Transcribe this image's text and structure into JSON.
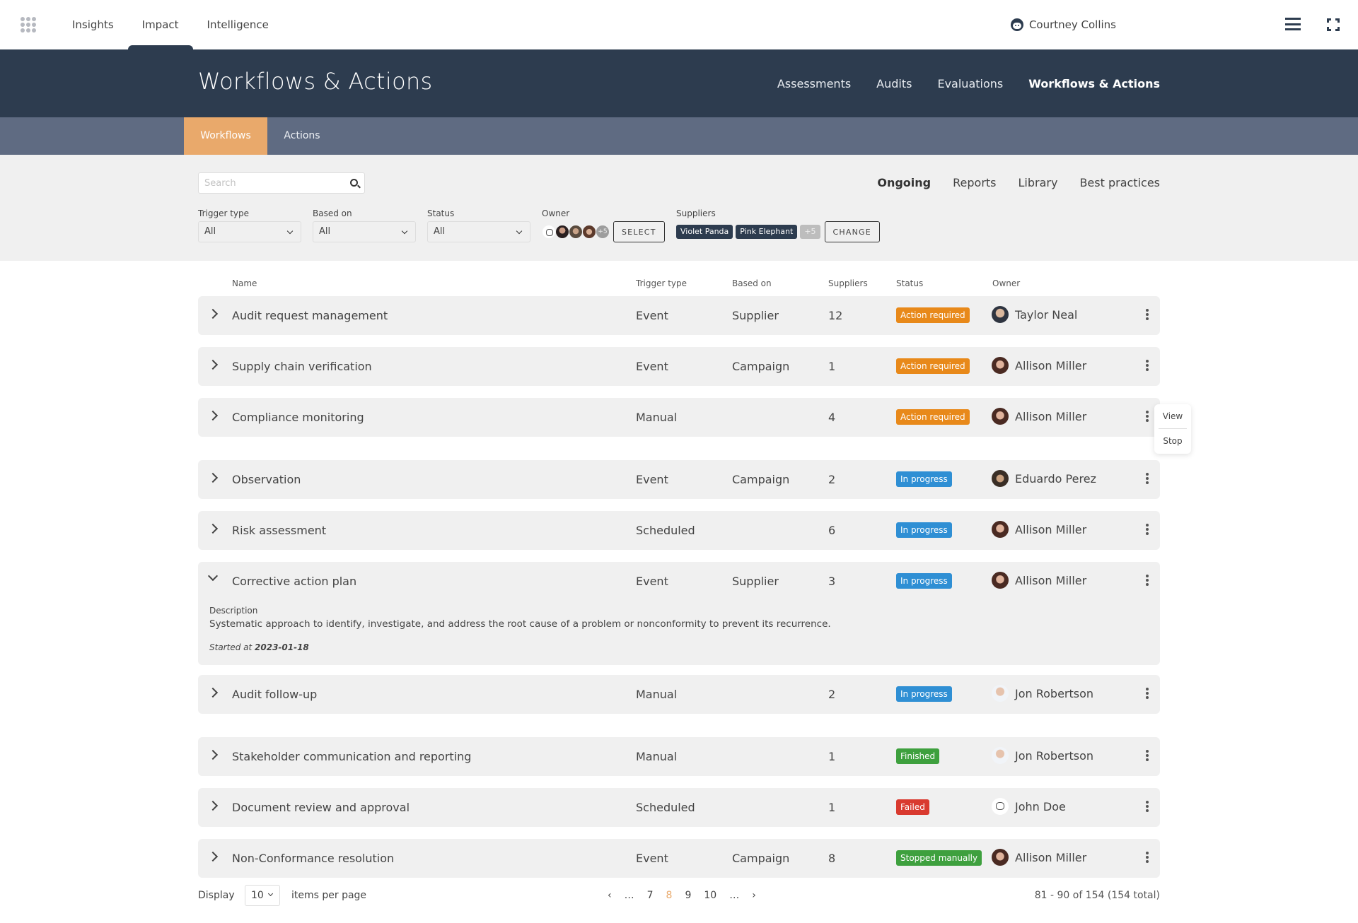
{
  "topbar": {
    "nav": [
      "Insights",
      "Impact",
      "Intelligence"
    ],
    "active_nav": "Impact",
    "user_name": "Courtney Collins"
  },
  "header": {
    "title": "Workflows & Actions",
    "nav": [
      "Assessments",
      "Audits",
      "Evaluations",
      "Workflows & Actions"
    ],
    "active_nav": "Workflows & Actions"
  },
  "subtabs": {
    "items": [
      "Workflows",
      "Actions"
    ],
    "active": "Workflows",
    "active_color": "#e9a96b"
  },
  "filters": {
    "search_placeholder": "Search",
    "search_value": "",
    "view_tabs": [
      "Ongoing",
      "Reports",
      "Library",
      "Best practices"
    ],
    "active_view": "Ongoing",
    "trigger_type": {
      "label": "Trigger type",
      "value": "All"
    },
    "based_on": {
      "label": "Based on",
      "value": "All"
    },
    "status": {
      "label": "Status",
      "value": "All"
    },
    "owner": {
      "label": "Owner",
      "more": "+5",
      "button": "SELECT"
    },
    "suppliers": {
      "label": "Suppliers",
      "chips": [
        "Violet Panda",
        "Pink Elephant"
      ],
      "more": "+5",
      "button": "CHANGE"
    }
  },
  "table": {
    "columns": [
      "Name",
      "Trigger type",
      "Based on",
      "Suppliers",
      "Status",
      "Owner"
    ],
    "rows": [
      {
        "name": "Audit request management",
        "trigger": "Event",
        "based_on": "Supplier",
        "suppliers": "12",
        "status": "Action required",
        "owner": "Taylor Neal"
      },
      {
        "name": "Supply chain verification",
        "trigger": "Event",
        "based_on": "Campaign",
        "suppliers": "1",
        "status": "Action required",
        "owner": "Allison Miller"
      },
      {
        "name": "Compliance monitoring",
        "trigger": "Manual",
        "based_on": "",
        "suppliers": "4",
        "status": "Action required",
        "owner": "Allison Miller"
      },
      {
        "name": "Observation",
        "trigger": "Event",
        "based_on": "Campaign",
        "suppliers": "2",
        "status": "In progress",
        "owner": "Eduardo Perez"
      },
      {
        "name": "Risk assessment",
        "trigger": "Scheduled",
        "based_on": "",
        "suppliers": "6",
        "status": "In progress",
        "owner": "Allison Miller"
      },
      {
        "name": "Corrective action plan",
        "trigger": "Event",
        "based_on": "Supplier",
        "suppliers": "3",
        "status": "In progress",
        "owner": "Allison Miller",
        "expanded": true,
        "description_label": "Description",
        "description": "Systematic approach to identify, investigate, and address the root cause of a problem or nonconformity to prevent its recurrence.",
        "started_label": "Started at",
        "started_date": "2023-01-18"
      },
      {
        "name": "Audit follow-up",
        "trigger": "Manual",
        "based_on": "",
        "suppliers": "2",
        "status": "In progress",
        "owner": "Jon Robertson"
      },
      {
        "name": "Stakeholder communication and reporting",
        "trigger": "Manual",
        "based_on": "",
        "suppliers": "1",
        "status": "Finished",
        "owner": "Jon Robertson"
      },
      {
        "name": "Document review and approval",
        "trigger": "Scheduled",
        "based_on": "",
        "suppliers": "1",
        "status": "Failed",
        "owner": "John Doe"
      },
      {
        "name": "Non-Conformance resolution",
        "trigger": "Event",
        "based_on": "Campaign",
        "suppliers": "8",
        "status": "Stopped manually",
        "owner": "Allison Miller"
      }
    ],
    "status_colors": {
      "Action required": "#e8891a",
      "In progress": "#2f8fd4",
      "Finished": "#3ea03e",
      "Failed": "#d93a2f",
      "Stopped manually": "#3ea03e"
    }
  },
  "row_menu": {
    "items": [
      "View",
      "Stop"
    ]
  },
  "pagination": {
    "display_label": "Display",
    "per_page_value": "10",
    "per_page_label": "items per page",
    "prev": "‹",
    "next": "›",
    "pages": [
      "…",
      "7",
      "8",
      "9",
      "10",
      "…"
    ],
    "current_page": "8",
    "range_text": "81 - 90 of 154 (154 total)"
  }
}
